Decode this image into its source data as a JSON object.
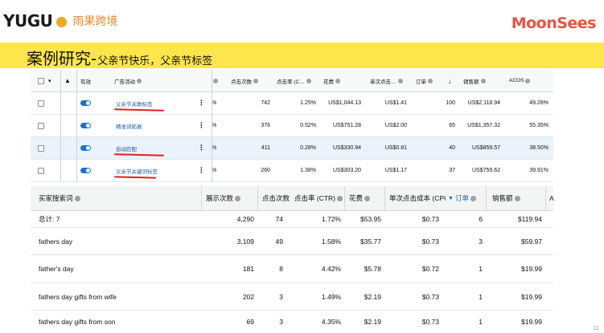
{
  "header": {
    "logo_left_prefix": "YUGU",
    "logo_left_suffix": "",
    "logo_left_cn": "雨果跨境",
    "logo_right": "MoonSees"
  },
  "title": {
    "main": "案例研究-",
    "sub": "父亲节快乐，父亲节标签"
  },
  "campaign_table": {
    "headers": {
      "active": "有效",
      "campaign": "广告活动",
      "clicks": "点击次数",
      "ctr": "点击率 (C…",
      "spend": "花费",
      "cpc": "单次点击…",
      "orders": "订单",
      "sales": "销售额",
      "acos": "ACOS"
    },
    "rows": [
      {
        "campaign": "父亲节关联标签",
        "pct": "%",
        "clicks": "742",
        "ctr": "1.25%",
        "spend": "US$1,044.13",
        "cpc": "US$1.41",
        "orders": "100",
        "sales": "US$2,118.94",
        "acos": "49.28%",
        "highlight": false
      },
      {
        "campaign": "精准词拓展",
        "pct": "%",
        "clicks": "376",
        "ctr": "0.52%",
        "spend": "US$751.28",
        "cpc": "US$2.00",
        "orders": "65",
        "sales": "US$1,357.32",
        "acos": "55.35%",
        "highlight": false
      },
      {
        "campaign": "自动匹配",
        "pct": "%",
        "clicks": "411",
        "ctr": "0.28%",
        "spend": "US$330.94",
        "cpc": "US$0.81",
        "orders": "40",
        "sales": "US$859.57",
        "acos": "38.50%",
        "highlight": true
      },
      {
        "campaign": "父亲节关键词标签",
        "pct": "%",
        "clicks": "260",
        "ctr": "1.38%",
        "spend": "US$303.20",
        "cpc": "US$1.17",
        "orders": "37",
        "sales": "US$759.62",
        "acos": "39.91%",
        "highlight": false
      }
    ]
  },
  "search_term_table": {
    "headers": {
      "term": "买家搜索词",
      "impressions": "展示次数",
      "clicks": "点击次数",
      "ctr": "点击率 (CTR)",
      "spend": "花费",
      "cpc": "单次点击成本 (CPC",
      "orders": "订单",
      "sales": "销售额",
      "extra": "A"
    },
    "total": {
      "term": "总计: 7",
      "impressions": "4,290",
      "clicks": "74",
      "ctr": "1.72%",
      "spend": "$53.95",
      "cpc": "$0.73",
      "orders": "6",
      "sales": "$119.94"
    },
    "rows": [
      {
        "term": "fathers day",
        "impressions": "3,109",
        "clicks": "49",
        "ctr": "1.58%",
        "spend": "$35.77",
        "cpc": "$0.73",
        "orders": "3",
        "sales": "$59.97"
      },
      {
        "term": "father's day",
        "impressions": "181",
        "clicks": "8",
        "ctr": "4.42%",
        "spend": "$5.78",
        "cpc": "$0.72",
        "orders": "1",
        "sales": "$19.99"
      },
      {
        "term": "fathers day gifts from wife",
        "impressions": "202",
        "clicks": "3",
        "ctr": "1.49%",
        "spend": "$2.19",
        "cpc": "$0.73",
        "orders": "1",
        "sales": "$19.99"
      },
      {
        "term": "fathers day gifts from son",
        "impressions": "69",
        "clicks": "3",
        "ctr": "4.35%",
        "spend": "$2.19",
        "cpc": "$0.73",
        "orders": "1",
        "sales": "$19.99"
      }
    ]
  },
  "colors": {
    "title_band": "#fde64b",
    "brand_orange": "#e8892b",
    "brand_red": "#e8543c",
    "link_blue": "#1a5ea8",
    "annotation_red": "#e02020",
    "row_highlight": "#eaf2fb"
  },
  "footer": {
    "page": "11"
  }
}
